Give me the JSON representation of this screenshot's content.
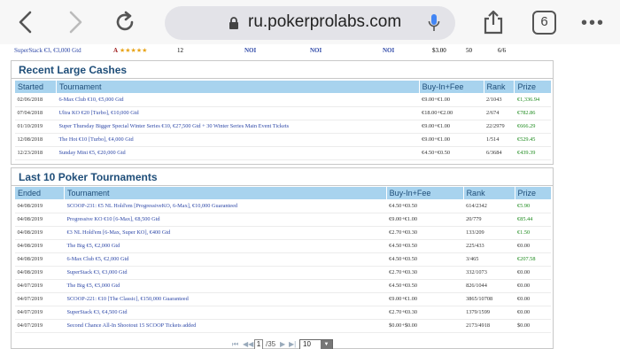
{
  "browser": {
    "url": "ru.pokerprolabs.com",
    "tab_count": "6"
  },
  "top_row": {
    "name": "SuperStack €3, €3,000 Gtd",
    "grade": "A",
    "stars": "★★★★★",
    "count": "12",
    "c1": "NOI",
    "c2": "NOI",
    "c3": "NOI",
    "buyin": "$3.00",
    "num": "50",
    "ratio": "6/6"
  },
  "large_cashes": {
    "title": "Recent Large Cashes",
    "headers": [
      "Started",
      "Tournament",
      "Buy-In+Fee",
      "Rank",
      "Prize"
    ],
    "rows": [
      {
        "date": "02/06/2018",
        "name": "6-Max Club €10, €5,000 Gtd",
        "buyin": "€9.00+€1.00",
        "rank": "2/1043",
        "prize": "€1,336.94"
      },
      {
        "date": "07/04/2018",
        "name": "Ultra KO €20 [Turbo], €10,000 Gtd",
        "buyin": "€18.00+€2.00",
        "rank": "2/674",
        "prize": "€782.86"
      },
      {
        "date": "01/10/2019",
        "name": "Super Thursday Bigger Special Winter Series €10, €27,500 Gtd + 30 Winter Series Main Event Tickets",
        "buyin": "€9.00+€1.00",
        "rank": "22/2979",
        "prize": "€666.29"
      },
      {
        "date": "12/08/2018",
        "name": "The Hot €10 [Turbo], €4,000 Gtd",
        "buyin": "€9.00+€1.00",
        "rank": "1/514",
        "prize": "€529.45"
      },
      {
        "date": "12/23/2018",
        "name": "Sunday Mini €5, €20,000 Gtd",
        "buyin": "€4.50+€0.50",
        "rank": "6/3684",
        "prize": "€439.39"
      }
    ]
  },
  "last_tournaments": {
    "title": "Last 10 Poker Tournaments",
    "headers": [
      "Ended",
      "Tournament",
      "Buy-In+Fee",
      "Rank",
      "Prize"
    ],
    "rows": [
      {
        "date": "04/08/2019",
        "name": "SCOOP-231: €5 NL Hold'em [ProgressiveKO, 6-Max], €10,000 Guaranteed",
        "buyin": "€4.50+€0.50",
        "rank": "614/2342",
        "prize": "€5.90",
        "green": true
      },
      {
        "date": "04/08/2019",
        "name": "Progressive KO €10 [6-Max], €8,500 Gtd",
        "buyin": "€9.00+€1.00",
        "rank": "20/779",
        "prize": "€85.44",
        "green": true
      },
      {
        "date": "04/08/2019",
        "name": "€3 NL Hold'em [6-Max, Super KO], €400 Gtd",
        "buyin": "€2.70+€0.30",
        "rank": "133/209",
        "prize": "€1.50",
        "green": true
      },
      {
        "date": "04/08/2019",
        "name": "The Big €5, €2,000 Gtd",
        "buyin": "€4.50+€0.50",
        "rank": "225/433",
        "prize": "€0.00",
        "green": false
      },
      {
        "date": "04/08/2019",
        "name": "6-Max Club €5, €2,000 Gtd",
        "buyin": "€4.50+€0.50",
        "rank": "3/465",
        "prize": "€207.58",
        "green": true
      },
      {
        "date": "04/08/2019",
        "name": "SuperStack €3, €3,000 Gtd",
        "buyin": "€2.70+€0.30",
        "rank": "332/1073",
        "prize": "€0.00",
        "green": false
      },
      {
        "date": "04/07/2019",
        "name": "The Big €5, €5,000 Gtd",
        "buyin": "€4.50+€0.50",
        "rank": "826/1044",
        "prize": "€0.00",
        "green": false
      },
      {
        "date": "04/07/2019",
        "name": "SCOOP-221: €10 [The Classic], €150,000 Guaranteed",
        "buyin": "€9.00+€1.00",
        "rank": "3865/10708",
        "prize": "€0.00",
        "green": false
      },
      {
        "date": "04/07/2019",
        "name": "SuperStack €3, €4,500 Gtd",
        "buyin": "€2.70+€0.30",
        "rank": "1379/1599",
        "prize": "€0.00",
        "green": false
      },
      {
        "date": "04/07/2019",
        "name": "Second Chance All-In Shootout 15 SCOOP Tickets added",
        "buyin": "$0.00+$0.00",
        "rank": "2173/4918",
        "prize": "$0.00",
        "green": false
      }
    ]
  },
  "pager": {
    "page": "1",
    "of": "/35",
    "per_page": "10"
  },
  "colors": {
    "header_bg": "#a8d3ee",
    "title": "#1f4e79",
    "link": "#2f49a8",
    "prize_green": "#1c8a1c"
  }
}
